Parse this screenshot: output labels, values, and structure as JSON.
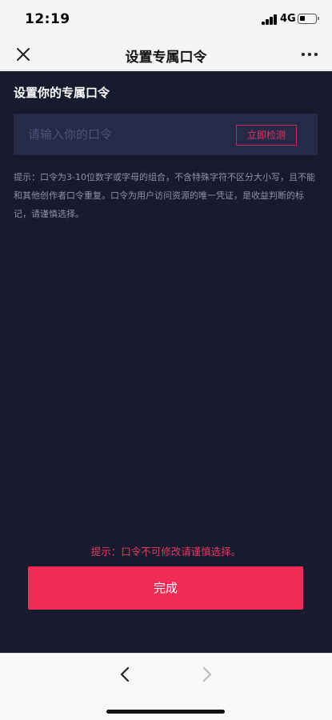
{
  "status_bar": {
    "time": "12:19",
    "network": "4G",
    "icons": [
      "signal-icon",
      "battery-icon"
    ]
  },
  "nav": {
    "title": "设置专属口令",
    "icons": [
      "close-icon",
      "more-icon"
    ]
  },
  "form": {
    "section_title": "设置你的专属口令",
    "input_placeholder": "请输入你的口令",
    "input_value": "",
    "check_button": "立即检测",
    "hint": "提示：口令为3-10位数字或字母的组合，不含特殊字符不区分大小写，且不能和其他创作者口令重复。口令为用户访问资源的唯一凭证，是收益判断的标记，请谨慎选择。",
    "warning": "提示：口令不可修改请谨慎选择。",
    "done_button": "完成"
  },
  "toolbar": {
    "icons": [
      "back-icon",
      "forward-icon"
    ]
  },
  "colors": {
    "panel_bg": "#181b2e",
    "input_bg": "#262a47",
    "accent": "#f02b55",
    "hint_text": "#8d90a8"
  }
}
